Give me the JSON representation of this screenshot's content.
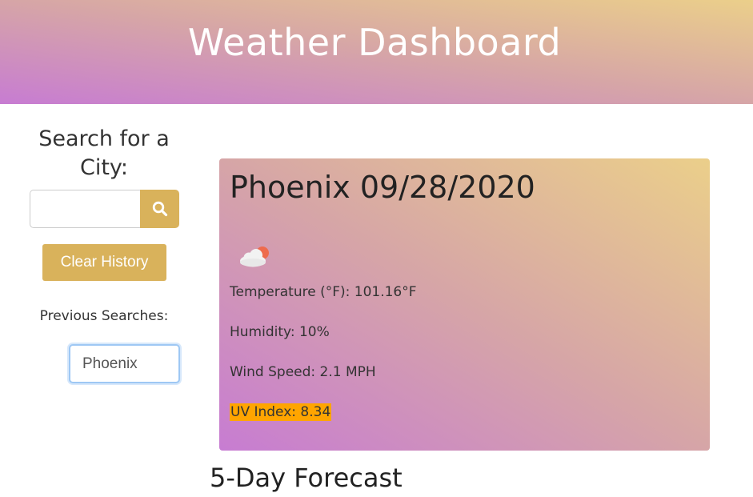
{
  "header": {
    "title": "Weather Dashboard"
  },
  "sidebar": {
    "search_title": "Search for a City:",
    "search_placeholder": "",
    "search_icon": "search-icon",
    "clear_label": "Clear History",
    "previous_label": "Previous Searches:",
    "history": [
      "Phoenix"
    ]
  },
  "current": {
    "city_date": "Phoenix 09/28/2020",
    "icon": "cloud-sun-icon",
    "temperature": "Temperature (°F): 101.16°F",
    "humidity": "Humidity: 10%",
    "wind": "Wind Speed: 2.1 MPH",
    "uv": "UV Index: 8.34",
    "uv_color": "#ffa500"
  },
  "forecast": {
    "title": "5-Day Forecast"
  },
  "colors": {
    "accent": "#d9b25b",
    "gradient_top": "#ebcf8a",
    "gradient_bottom": "#c77cd2"
  }
}
